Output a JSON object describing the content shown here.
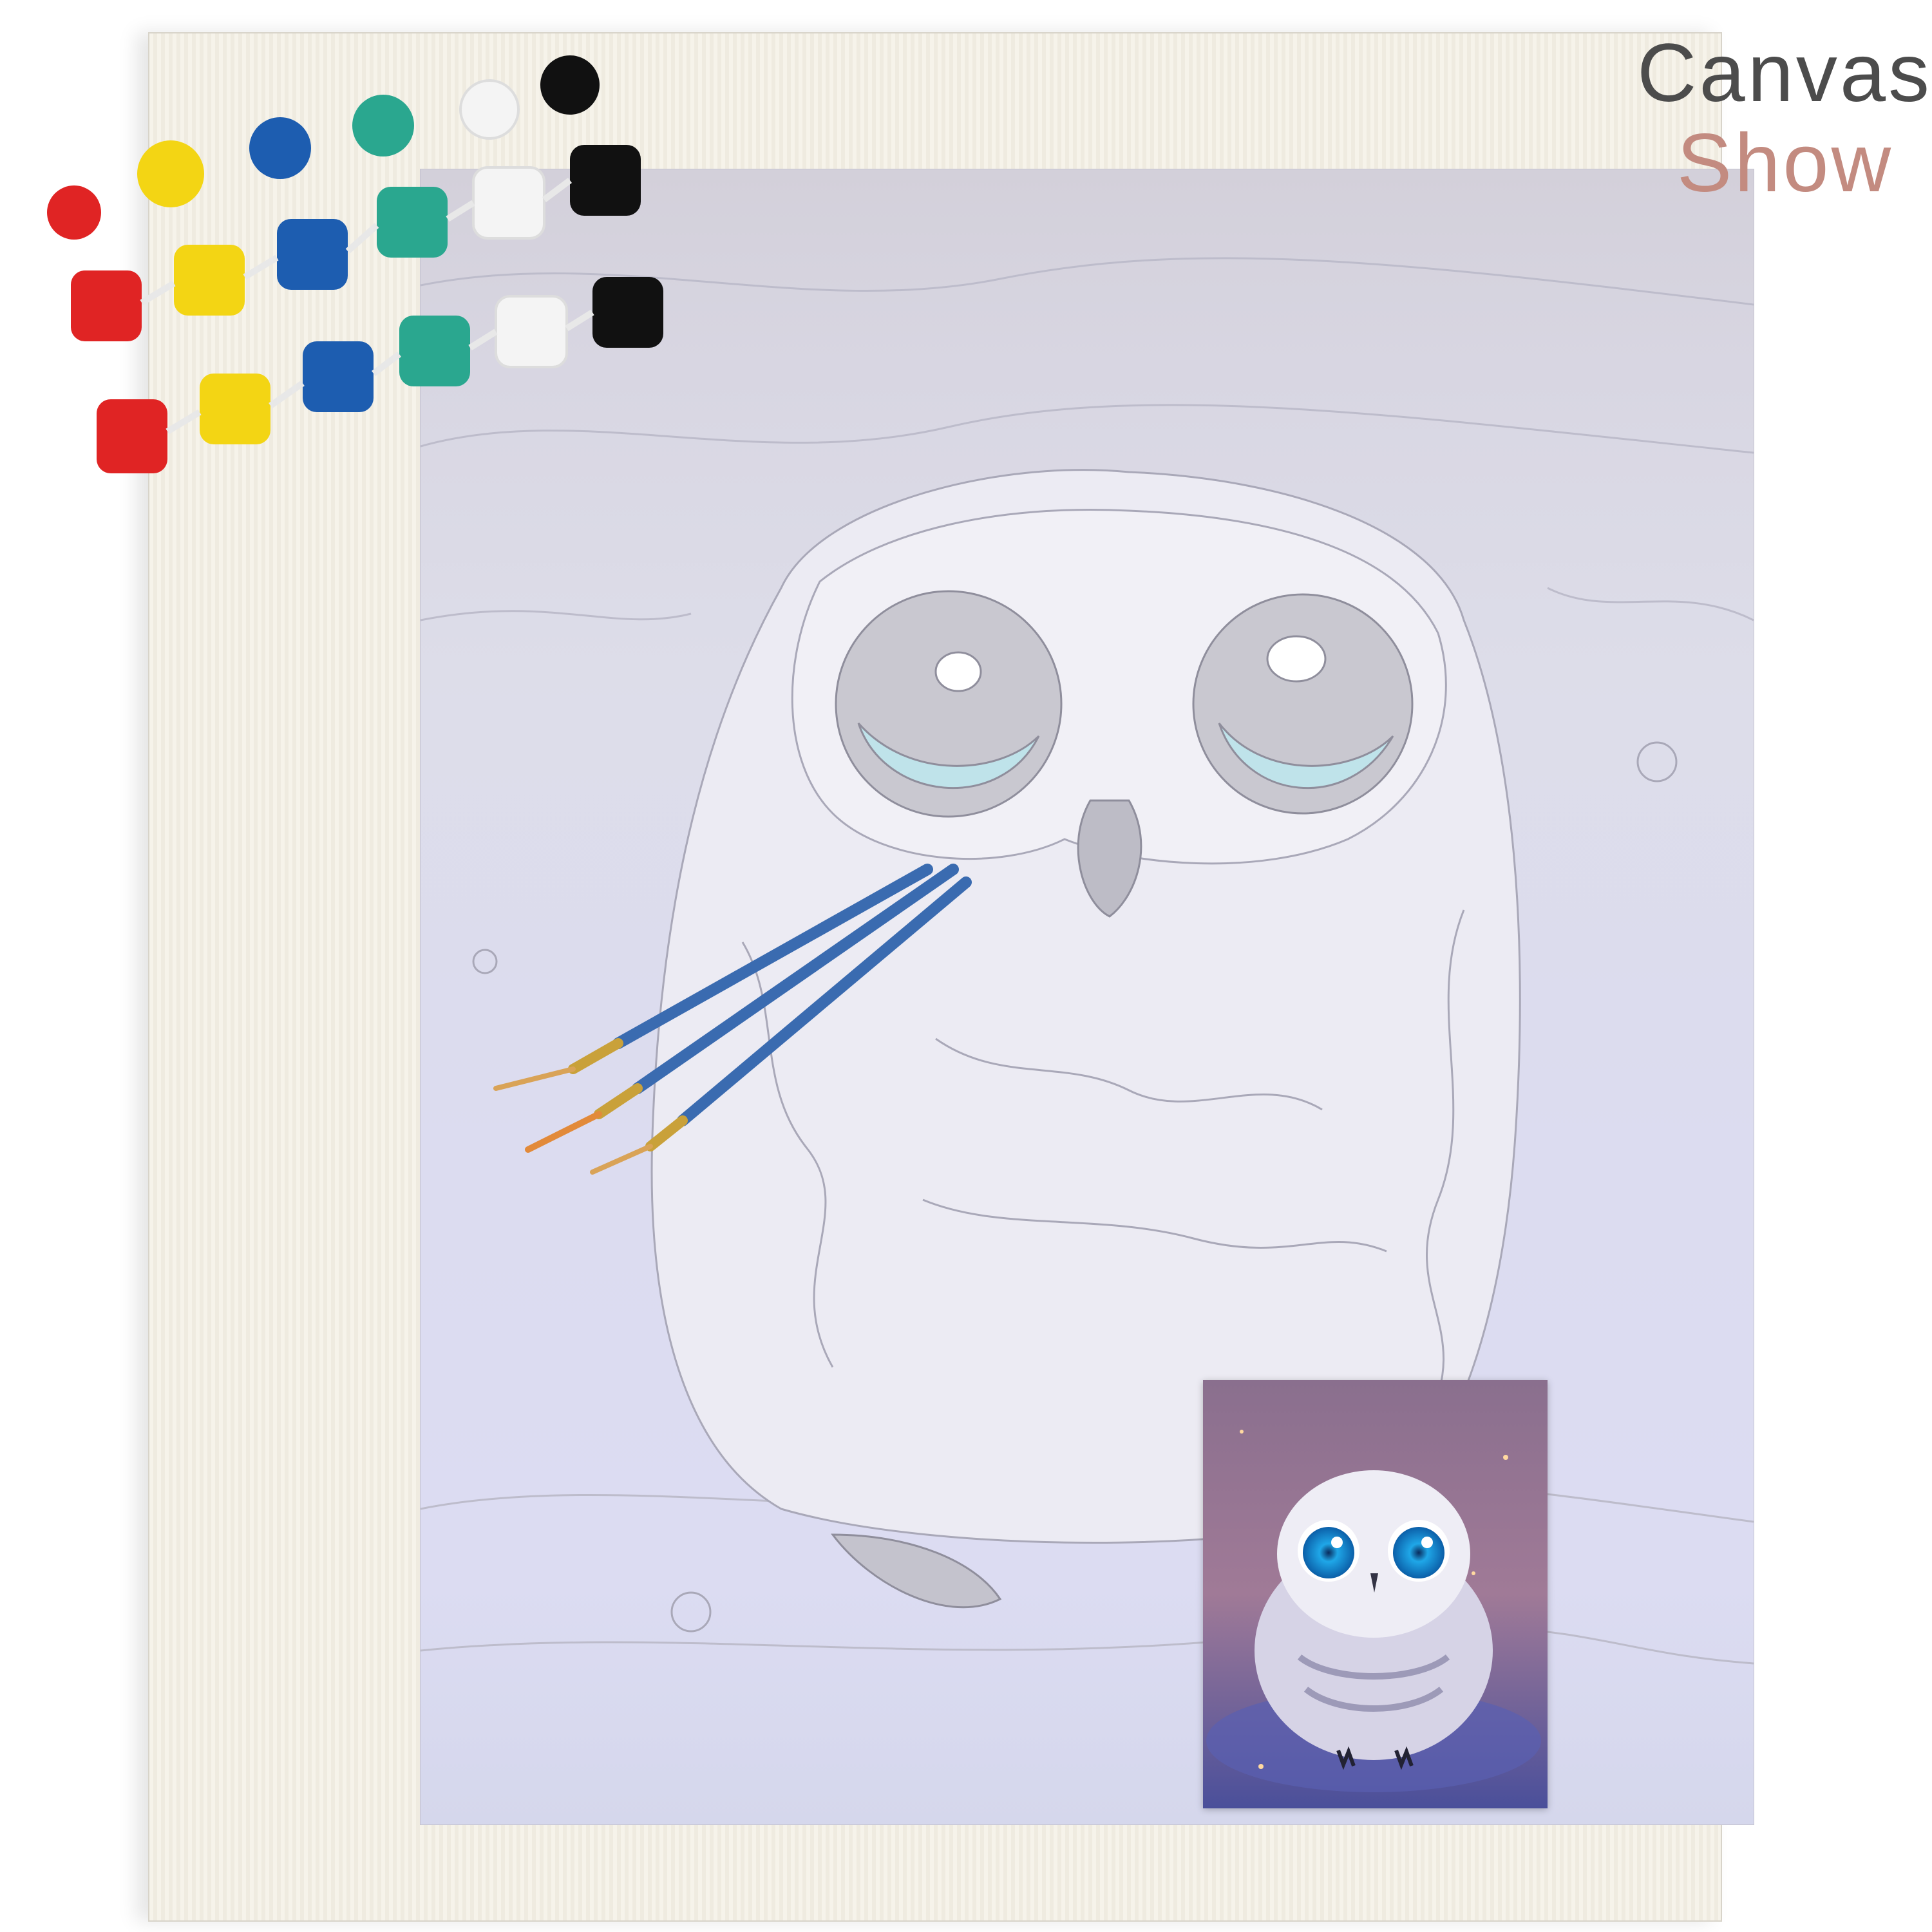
{
  "brand": {
    "line1": "Canvas",
    "line2": "Show"
  },
  "colors": {
    "brand_primary": "#4c4c4c",
    "brand_accent": "#c38b80",
    "canvas": "#f6f3ea",
    "outline_area": "#dcdcf0",
    "brush_handle": "#3a6bb0",
    "brush_ferrule": "#c9a13a",
    "paints": [
      "#e02424",
      "#f3d514",
      "#1d5db0",
      "#2aa78f",
      "#ffffff",
      "#111111"
    ]
  },
  "illustration": {
    "subject_icon": "owl-icon",
    "palette_icon": "paint-pot-icon",
    "tool_icon": "paintbrush-icon"
  }
}
